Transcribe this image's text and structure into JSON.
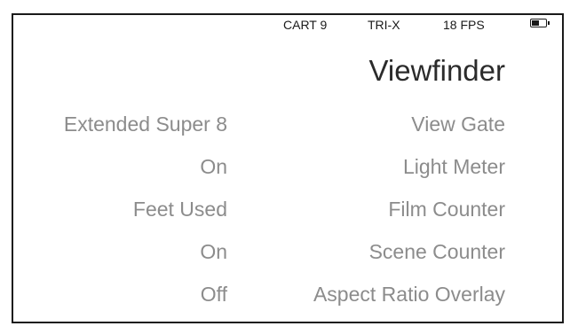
{
  "status_bar": {
    "cartridge": "CART 9",
    "film_stock": "TRI-X",
    "frame_rate": "18 FPS",
    "battery_level": 0.6
  },
  "page": {
    "title": "Viewfinder"
  },
  "settings": [
    {
      "label": "View Gate",
      "value": "Extended Super 8"
    },
    {
      "label": "Light Meter",
      "value": "On"
    },
    {
      "label": "Film Counter",
      "value": "Feet Used"
    },
    {
      "label": "Scene Counter",
      "value": "On"
    },
    {
      "label": "Aspect Ratio Overlay",
      "value": "Off"
    }
  ]
}
